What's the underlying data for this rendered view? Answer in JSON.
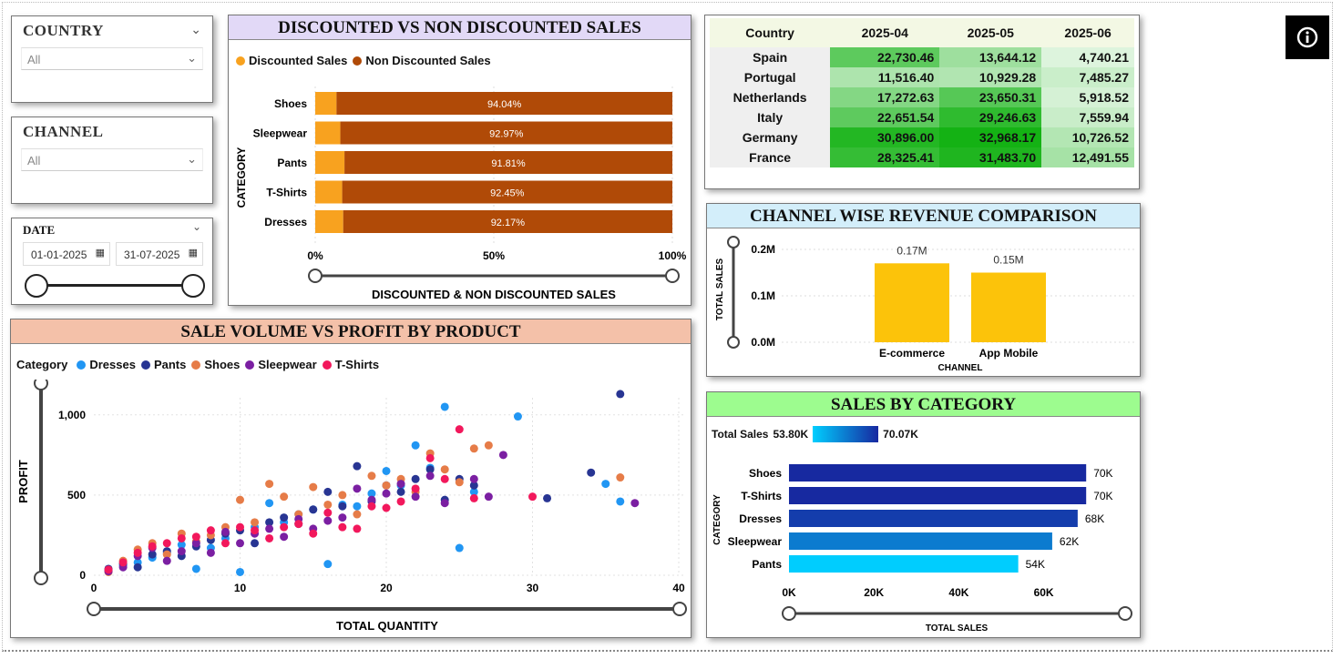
{
  "filters": {
    "country": {
      "title": "COUNTRY",
      "value": "All"
    },
    "channel": {
      "title": "CHANNEL",
      "value": "All"
    },
    "date": {
      "title": "DATE",
      "start": "01-01-2025",
      "end": "31-07-2025"
    }
  },
  "colors": {
    "discounted": "#f8a21f",
    "non_discounted": "#b04a07",
    "channel_bar": "#fcc30a",
    "category_dark": "#1728a0",
    "category_light": "#00cfff",
    "dresses": "#2196f3",
    "pants": "#283593",
    "shoes": "#e67c48",
    "sleepwear": "#7b1fa2",
    "tshirts": "#f2185c"
  },
  "info_button": {
    "icon": "info-icon"
  },
  "discount_chart": {
    "title": "DISCOUNTED VS NON DISCOUNTED SALES",
    "legend": [
      "Discounted Sales",
      "Non Discounted Sales"
    ],
    "y_axis_label": "CATEGORY",
    "x_axis_label": "DISCOUNTED & NON DISCOUNTED SALES",
    "x_ticks": [
      "0%",
      "50%",
      "100%"
    ],
    "categories": [
      "Shoes",
      "Sleepwear",
      "Pants",
      "T-Shirts",
      "Dresses"
    ],
    "non_discounted_pct": [
      94.04,
      92.97,
      91.81,
      92.45,
      92.17
    ],
    "labels": [
      "94.04%",
      "92.97%",
      "91.81%",
      "92.45%",
      "92.17%"
    ]
  },
  "matrix": {
    "header": [
      "Country",
      "2025-04",
      "2025-05",
      "2025-06"
    ],
    "rows": [
      {
        "country": "Spain",
        "values": [
          "22,730.46",
          "13,644.12",
          "4,740.21"
        ],
        "raw": [
          22730.46,
          13644.12,
          4740.21
        ]
      },
      {
        "country": "Portugal",
        "values": [
          "11,516.40",
          "10,929.28",
          "7,485.27"
        ],
        "raw": [
          11516.4,
          10929.28,
          7485.27
        ]
      },
      {
        "country": "Netherlands",
        "values": [
          "17,272.63",
          "23,650.31",
          "5,918.52"
        ],
        "raw": [
          17272.63,
          23650.31,
          5918.52
        ]
      },
      {
        "country": "Italy",
        "values": [
          "22,651.54",
          "29,246.63",
          "7,559.94"
        ],
        "raw": [
          22651.54,
          29246.63,
          7559.94
        ]
      },
      {
        "country": "Germany",
        "values": [
          "30,896.00",
          "32,968.17",
          "10,726.52"
        ],
        "raw": [
          30896.0,
          32968.17,
          10726.52
        ]
      },
      {
        "country": "France",
        "values": [
          "28,325.41",
          "31,483.70",
          "12,491.55"
        ],
        "raw": [
          28325.41,
          31483.7,
          12491.55
        ]
      }
    ]
  },
  "channel_chart": {
    "title": "CHANNEL WISE REVENUE COMPARISON",
    "y_axis_label": "TOTAL SALES",
    "x_axis_label": "CHANNEL",
    "y_ticks": [
      "0.2M",
      "0.1M",
      "0.0M"
    ],
    "categories": [
      "E-commerce",
      "App Mobile"
    ],
    "values": [
      0.17,
      0.15
    ],
    "labels": [
      "0.17M",
      "0.15M"
    ]
  },
  "category_chart": {
    "title": "SALES BY CATEGORY",
    "scale_label": "Total Sales",
    "scale_min": "53.80K",
    "scale_max": "70.07K",
    "y_axis_label": "CATEGORY",
    "x_axis_label": "TOTAL SALES",
    "x_ticks": [
      "0K",
      "20K",
      "40K",
      "60K"
    ],
    "categories": [
      "Shoes",
      "T-Shirts",
      "Dresses",
      "Sleepwear",
      "Pants"
    ],
    "values": [
      70,
      70,
      68,
      62,
      54
    ],
    "labels": [
      "70K",
      "70K",
      "68K",
      "62K",
      "54K"
    ]
  },
  "scatter_chart": {
    "title": "SALE VOLUME VS PROFIT BY PRODUCT",
    "legend_title": "Category",
    "legend": [
      "Dresses",
      "Pants",
      "Shoes",
      "Sleepwear",
      "T-Shirts"
    ],
    "y_axis_label": "PROFIT",
    "x_axis_label": "TOTAL QUANTITY",
    "x_ticks": [
      "0",
      "10",
      "20",
      "30",
      "40"
    ],
    "y_ticks": [
      "1,000",
      "500",
      "0"
    ]
  },
  "chart_data": [
    {
      "type": "bar",
      "title": "DISCOUNTED VS NON DISCOUNTED SALES",
      "orientation": "horizontal-stacked-100",
      "categories": [
        "Shoes",
        "Sleepwear",
        "Pants",
        "T-Shirts",
        "Dresses"
      ],
      "series": [
        {
          "name": "Discounted Sales",
          "values": [
            5.96,
            7.03,
            8.19,
            7.55,
            7.83
          ]
        },
        {
          "name": "Non Discounted Sales",
          "values": [
            94.04,
            92.97,
            91.81,
            92.45,
            92.17
          ]
        }
      ],
      "xlabel": "DISCOUNTED & NON DISCOUNTED SALES",
      "ylabel": "CATEGORY",
      "xlim": [
        0,
        100
      ],
      "legend": "top-left"
    },
    {
      "type": "bar",
      "title": "CHANNEL WISE REVENUE COMPARISON",
      "categories": [
        "E-commerce",
        "App Mobile"
      ],
      "values": [
        0.17,
        0.15
      ],
      "xlabel": "CHANNEL",
      "ylabel": "TOTAL SALES",
      "ylim": [
        0,
        0.2
      ]
    },
    {
      "type": "bar",
      "title": "SALES BY CATEGORY",
      "orientation": "horizontal",
      "categories": [
        "Shoes",
        "T-Shirts",
        "Dresses",
        "Sleepwear",
        "Pants"
      ],
      "values": [
        70,
        70,
        68,
        62,
        54
      ],
      "xlabel": "TOTAL SALES",
      "ylabel": "CATEGORY",
      "xlim": [
        0,
        75
      ]
    },
    {
      "type": "scatter",
      "title": "SALE VOLUME VS PROFIT BY PRODUCT",
      "xlabel": "TOTAL QUANTITY",
      "ylabel": "PROFIT",
      "xlim": [
        0,
        40
      ],
      "ylim": [
        0,
        1250
      ],
      "legend": "top-left",
      "series": [
        {
          "name": "Dresses",
          "color": "#2196f3",
          "points": [
            [
              1,
              30
            ],
            [
              2,
              60
            ],
            [
              3,
              80
            ],
            [
              4,
              110
            ],
            [
              5,
              140
            ],
            [
              6,
              190
            ],
            [
              7,
              40
            ],
            [
              8,
              170
            ],
            [
              9,
              230
            ],
            [
              10,
              20
            ],
            [
              11,
              300
            ],
            [
              12,
              450
            ],
            [
              13,
              330
            ],
            [
              14,
              380
            ],
            [
              15,
              410
            ],
            [
              16,
              70
            ],
            [
              17,
              440
            ],
            [
              18,
              430
            ],
            [
              19,
              510
            ],
            [
              20,
              650
            ],
            [
              21,
              560
            ],
            [
              22,
              810
            ],
            [
              23,
              670
            ],
            [
              24,
              1050
            ],
            [
              25,
              170
            ],
            [
              26,
              520
            ],
            [
              29,
              990
            ],
            [
              35,
              570
            ],
            [
              36,
              460
            ]
          ]
        },
        {
          "name": "Pants",
          "color": "#283593",
          "points": [
            [
              1,
              40
            ],
            [
              2,
              70
            ],
            [
              3,
              50
            ],
            [
              4,
              130
            ],
            [
              5,
              150
            ],
            [
              6,
              120
            ],
            [
              7,
              180
            ],
            [
              8,
              220
            ],
            [
              9,
              260
            ],
            [
              10,
              280
            ],
            [
              11,
              200
            ],
            [
              12,
              330
            ],
            [
              13,
              360
            ],
            [
              14,
              320
            ],
            [
              15,
              410
            ],
            [
              16,
              520
            ],
            [
              17,
              430
            ],
            [
              18,
              680
            ],
            [
              19,
              460
            ],
            [
              20,
              560
            ],
            [
              21,
              520
            ],
            [
              22,
              600
            ],
            [
              23,
              660
            ],
            [
              24,
              470
            ],
            [
              25,
              600
            ],
            [
              26,
              560
            ],
            [
              31,
              480
            ],
            [
              34,
              640
            ],
            [
              36,
              1130
            ]
          ]
        },
        {
          "name": "Shoes",
          "color": "#e67c48",
          "points": [
            [
              1,
              20
            ],
            [
              2,
              90
            ],
            [
              3,
              160
            ],
            [
              4,
              200
            ],
            [
              5,
              130
            ],
            [
              6,
              260
            ],
            [
              7,
              210
            ],
            [
              8,
              250
            ],
            [
              9,
              300
            ],
            [
              10,
              470
            ],
            [
              11,
              330
            ],
            [
              12,
              570
            ],
            [
              13,
              490
            ],
            [
              14,
              380
            ],
            [
              15,
              550
            ],
            [
              16,
              440
            ],
            [
              17,
              500
            ],
            [
              18,
              380
            ],
            [
              19,
              620
            ],
            [
              20,
              560
            ],
            [
              21,
              600
            ],
            [
              22,
              520
            ],
            [
              23,
              760
            ],
            [
              24,
              660
            ],
            [
              25,
              580
            ],
            [
              26,
              790
            ],
            [
              27,
              810
            ],
            [
              36,
              610
            ]
          ]
        },
        {
          "name": "Sleepwear",
          "color": "#7b1fa2",
          "points": [
            [
              1,
              25
            ],
            [
              2,
              50
            ],
            [
              3,
              120
            ],
            [
              4,
              170
            ],
            [
              5,
              90
            ],
            [
              6,
              150
            ],
            [
              7,
              200
            ],
            [
              8,
              140
            ],
            [
              9,
              270
            ],
            [
              10,
              200
            ],
            [
              11,
              260
            ],
            [
              12,
              290
            ],
            [
              13,
              240
            ],
            [
              14,
              350
            ],
            [
              15,
              290
            ],
            [
              16,
              340
            ],
            [
              17,
              360
            ],
            [
              18,
              540
            ],
            [
              19,
              470
            ],
            [
              20,
              510
            ],
            [
              21,
              570
            ],
            [
              22,
              490
            ],
            [
              23,
              620
            ],
            [
              24,
              450
            ],
            [
              26,
              600
            ],
            [
              27,
              490
            ],
            [
              28,
              750
            ],
            [
              37,
              450
            ]
          ]
        },
        {
          "name": "T-Shirts",
          "color": "#f2185c",
          "points": [
            [
              1,
              35
            ],
            [
              2,
              80
            ],
            [
              3,
              140
            ],
            [
              4,
              180
            ],
            [
              5,
              200
            ],
            [
              6,
              230
            ],
            [
              7,
              240
            ],
            [
              8,
              280
            ],
            [
              9,
              200
            ],
            [
              10,
              300
            ],
            [
              11,
              280
            ],
            [
              12,
              230
            ],
            [
              13,
              300
            ],
            [
              14,
              320
            ],
            [
              15,
              260
            ],
            [
              16,
              390
            ],
            [
              17,
              300
            ],
            [
              18,
              290
            ],
            [
              19,
              430
            ],
            [
              20,
              420
            ],
            [
              21,
              460
            ],
            [
              22,
              540
            ],
            [
              23,
              730
            ],
            [
              24,
              600
            ],
            [
              25,
              910
            ],
            [
              26,
              480
            ],
            [
              30,
              490
            ]
          ]
        }
      ]
    }
  ]
}
